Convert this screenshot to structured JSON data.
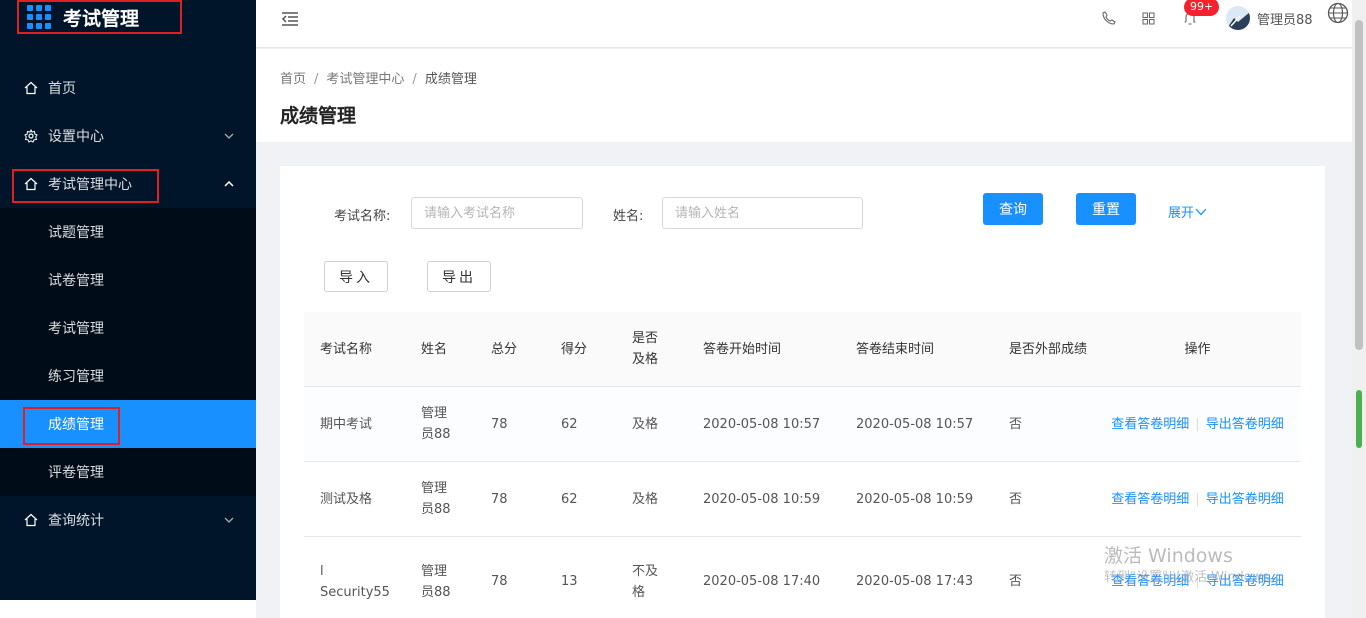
{
  "app": {
    "title": "考试管理"
  },
  "sidebar": {
    "items": [
      {
        "label": "首页",
        "icon": "home-icon"
      },
      {
        "label": "设置中心",
        "icon": "gear-icon"
      },
      {
        "label": "考试管理中心",
        "icon": "home-icon",
        "expanded": true,
        "children": [
          "试题管理",
          "试卷管理",
          "考试管理",
          "练习管理",
          "成绩管理",
          "评卷管理"
        ],
        "active_child": "成绩管理"
      },
      {
        "label": "查询统计",
        "icon": "home-icon"
      }
    ]
  },
  "header": {
    "notification_badge": "99+",
    "user_name": "管理员88"
  },
  "breadcrumb": [
    "首页",
    "考试管理中心",
    "成绩管理"
  ],
  "page_title": "成绩管理",
  "search": {
    "exam_name_label": "考试名称:",
    "exam_name_placeholder": "请输入考试名称",
    "name_label": "姓名:",
    "name_placeholder": "请输入姓名",
    "query_button": "查询",
    "reset_button": "重置",
    "expand_link": "展开"
  },
  "actions": {
    "import_button": "导入",
    "export_button": "导出"
  },
  "table": {
    "columns": [
      "考试名称",
      "姓名",
      "总分",
      "得分",
      "是否及格",
      "答卷开始时间",
      "答卷结束时间",
      "是否外部成绩",
      "操作"
    ],
    "rows": [
      {
        "exam": "期中考试",
        "name": "管理员88",
        "total": "78",
        "score": "62",
        "passed": "及格",
        "start": "2020-05-08 10:57",
        "end": "2020-05-08 10:57",
        "external": "否"
      },
      {
        "exam": "测试及格",
        "name": "管理员88",
        "total": "78",
        "score": "62",
        "passed": "及格",
        "start": "2020-05-08 10:59",
        "end": "2020-05-08 10:59",
        "external": "否"
      },
      {
        "exam": "l Security55",
        "name": "管理员88",
        "total": "78",
        "score": "13",
        "passed": "不及格",
        "start": "2020-05-08 17:40",
        "end": "2020-05-08 17:43",
        "external": "否"
      }
    ],
    "op_view": "查看答卷明细",
    "op_export": "导出答卷明细"
  },
  "watermark": {
    "line1": "激活 Windows",
    "line2": "转到\"设置\"以激活 Windows。"
  },
  "colors": {
    "sidebar_bg": "#001529",
    "submenu_bg": "#000c17",
    "primary": "#1890ff",
    "highlight_box": "#e02020",
    "badge": "#f5222d"
  }
}
